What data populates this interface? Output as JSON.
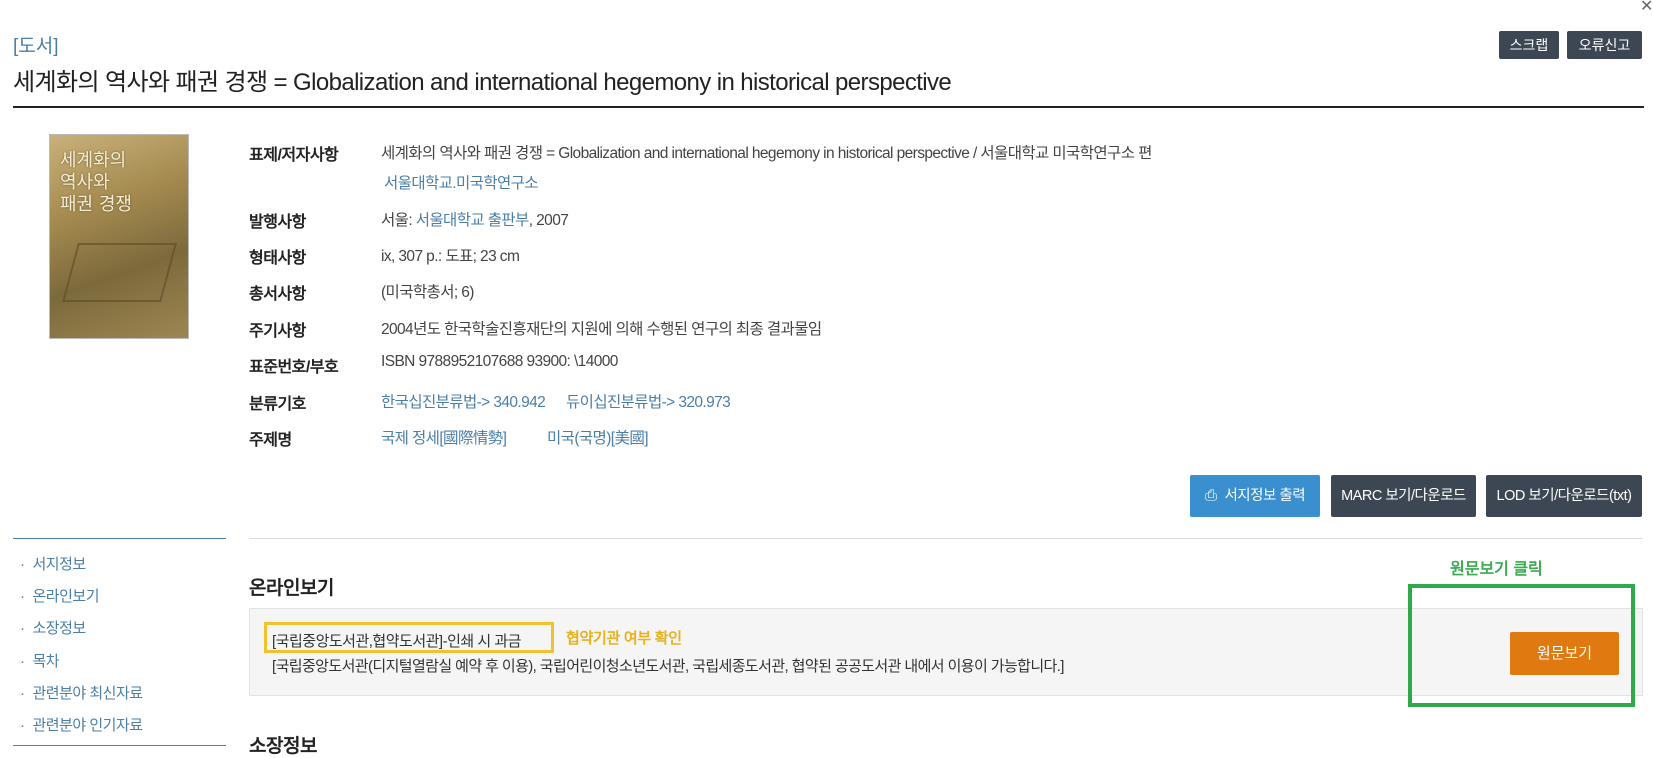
{
  "header": {
    "category": "[도서]",
    "title": "세계화의 역사와 패권 경쟁 = Globalization and international hegemony in historical perspective",
    "scrap_label": "스크랩",
    "report_label": "오류신고"
  },
  "cover": {
    "title_line1": "세계화의",
    "title_line2": "역사와",
    "title_line3": "패권 경쟁"
  },
  "record": {
    "rows": [
      {
        "label": "표제/저자사항",
        "value": "세계화의 역사와 패권 경쟁 = Globalization and international hegemony in historical perspective / 서울대학교 미국학연구소 편",
        "link": "서울대학교.미국학연구소"
      },
      {
        "label": "발행사항",
        "value_prefix": "서울: ",
        "link": "서울대학교 출판부",
        "value_suffix": ", 2007"
      },
      {
        "label": "형태사항",
        "value": "ix, 307 p.: 도표; 23 cm"
      },
      {
        "label": "총서사항",
        "value": "(미국학총서; 6)"
      },
      {
        "label": "주기사항",
        "value": "2004년도 한국학술진흥재단의 지원에 의해 수행된 연구의 최종 결과물임"
      },
      {
        "label": "표준번호/부호",
        "value": "ISBN 9788952107688 93900: \\14000"
      },
      {
        "label": "분류기호",
        "link1": "한국십진분류법-> 340.942",
        "link2": "듀이십진분류법-> 320.973"
      },
      {
        "label": "주제명",
        "link1": "국제 정세[國際情勢]",
        "link2": "미국(국명)[美國]"
      }
    ]
  },
  "actions": {
    "print_label": "서지정보 출력",
    "marc_label": "MARC 보기/다운로드",
    "lod_label": "LOD 보기/다운로드(txt)"
  },
  "sidebar": {
    "items": [
      {
        "label": "서지정보"
      },
      {
        "label": "온라인보기"
      },
      {
        "label": "소장정보"
      },
      {
        "label": "목차"
      },
      {
        "label": "관련분야 최신자료"
      },
      {
        "label": "관련분야 인기자료"
      }
    ]
  },
  "online": {
    "heading": "온라인보기",
    "access_line1": "[국립중앙도서관,협약도서관]-인쇄 시 과금",
    "access_line2": "[국립중앙도서관(디지털열람실 예약 후 이용), 국립어린이청소년도서관, 국립세종도서관, 협약된 공공도서관 내에서 이용이 가능합니다.]",
    "yellow_note": "협약기관 여부 확인",
    "green_note": "원문보기 클릭",
    "view_label": "원문보기"
  },
  "holdings": {
    "heading": "소장정보"
  },
  "colors": {
    "link": "#4a7fa8",
    "dark_button": "#3d4754",
    "print_button": "#3a8fcf",
    "view_button": "#e07a10",
    "highlight_yellow": "#f2c12e",
    "highlight_green": "#2faa4a"
  }
}
